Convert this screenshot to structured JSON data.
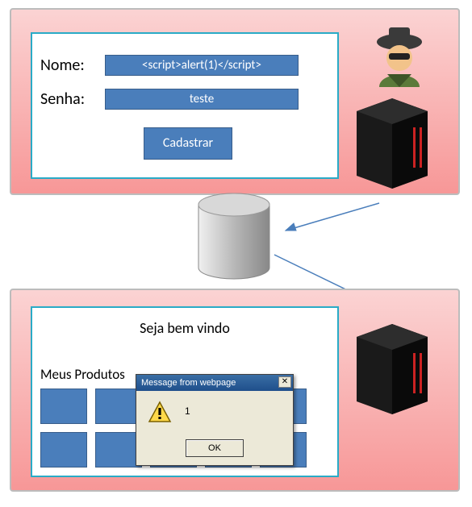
{
  "form": {
    "name_label": "Nome:",
    "name_value": "<script>alert(1)</script>",
    "password_label": "Senha:",
    "password_value": "teste",
    "submit_label": "Cadastrar"
  },
  "result": {
    "welcome": "Seja bem vindo",
    "products_title": "Meus Produtos"
  },
  "dialog": {
    "title": "Message from webpage",
    "message": "1",
    "ok_label": "OK",
    "close_glyph": "✕"
  }
}
